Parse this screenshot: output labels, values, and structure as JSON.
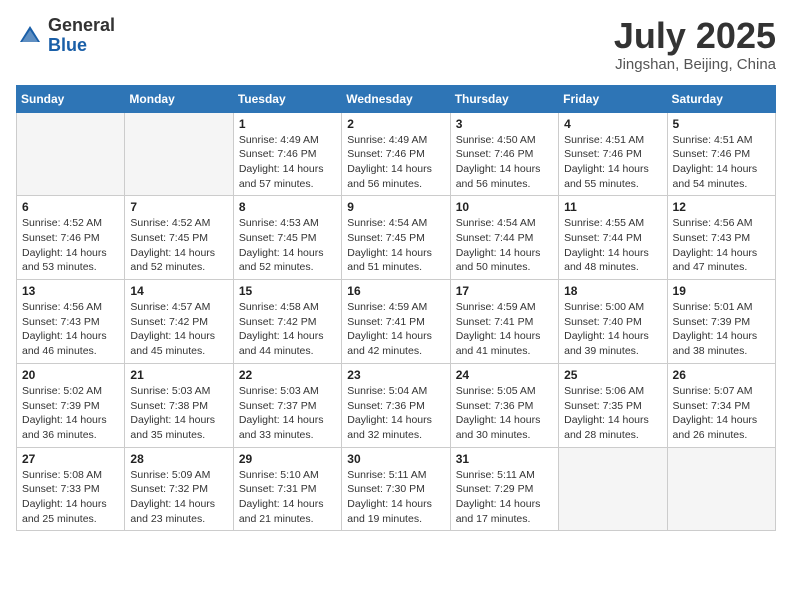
{
  "header": {
    "logo_general": "General",
    "logo_blue": "Blue",
    "month_title": "July 2025",
    "location": "Jingshan, Beijing, China"
  },
  "weekdays": [
    "Sunday",
    "Monday",
    "Tuesday",
    "Wednesday",
    "Thursday",
    "Friday",
    "Saturday"
  ],
  "weeks": [
    [
      {
        "day": "",
        "empty": true
      },
      {
        "day": "",
        "empty": true
      },
      {
        "day": "1",
        "sunrise": "Sunrise: 4:49 AM",
        "sunset": "Sunset: 7:46 PM",
        "daylight": "Daylight: 14 hours and 57 minutes."
      },
      {
        "day": "2",
        "sunrise": "Sunrise: 4:49 AM",
        "sunset": "Sunset: 7:46 PM",
        "daylight": "Daylight: 14 hours and 56 minutes."
      },
      {
        "day": "3",
        "sunrise": "Sunrise: 4:50 AM",
        "sunset": "Sunset: 7:46 PM",
        "daylight": "Daylight: 14 hours and 56 minutes."
      },
      {
        "day": "4",
        "sunrise": "Sunrise: 4:51 AM",
        "sunset": "Sunset: 7:46 PM",
        "daylight": "Daylight: 14 hours and 55 minutes."
      },
      {
        "day": "5",
        "sunrise": "Sunrise: 4:51 AM",
        "sunset": "Sunset: 7:46 PM",
        "daylight": "Daylight: 14 hours and 54 minutes."
      }
    ],
    [
      {
        "day": "6",
        "sunrise": "Sunrise: 4:52 AM",
        "sunset": "Sunset: 7:46 PM",
        "daylight": "Daylight: 14 hours and 53 minutes."
      },
      {
        "day": "7",
        "sunrise": "Sunrise: 4:52 AM",
        "sunset": "Sunset: 7:45 PM",
        "daylight": "Daylight: 14 hours and 52 minutes."
      },
      {
        "day": "8",
        "sunrise": "Sunrise: 4:53 AM",
        "sunset": "Sunset: 7:45 PM",
        "daylight": "Daylight: 14 hours and 52 minutes."
      },
      {
        "day": "9",
        "sunrise": "Sunrise: 4:54 AM",
        "sunset": "Sunset: 7:45 PM",
        "daylight": "Daylight: 14 hours and 51 minutes."
      },
      {
        "day": "10",
        "sunrise": "Sunrise: 4:54 AM",
        "sunset": "Sunset: 7:44 PM",
        "daylight": "Daylight: 14 hours and 50 minutes."
      },
      {
        "day": "11",
        "sunrise": "Sunrise: 4:55 AM",
        "sunset": "Sunset: 7:44 PM",
        "daylight": "Daylight: 14 hours and 48 minutes."
      },
      {
        "day": "12",
        "sunrise": "Sunrise: 4:56 AM",
        "sunset": "Sunset: 7:43 PM",
        "daylight": "Daylight: 14 hours and 47 minutes."
      }
    ],
    [
      {
        "day": "13",
        "sunrise": "Sunrise: 4:56 AM",
        "sunset": "Sunset: 7:43 PM",
        "daylight": "Daylight: 14 hours and 46 minutes."
      },
      {
        "day": "14",
        "sunrise": "Sunrise: 4:57 AM",
        "sunset": "Sunset: 7:42 PM",
        "daylight": "Daylight: 14 hours and 45 minutes."
      },
      {
        "day": "15",
        "sunrise": "Sunrise: 4:58 AM",
        "sunset": "Sunset: 7:42 PM",
        "daylight": "Daylight: 14 hours and 44 minutes."
      },
      {
        "day": "16",
        "sunrise": "Sunrise: 4:59 AM",
        "sunset": "Sunset: 7:41 PM",
        "daylight": "Daylight: 14 hours and 42 minutes."
      },
      {
        "day": "17",
        "sunrise": "Sunrise: 4:59 AM",
        "sunset": "Sunset: 7:41 PM",
        "daylight": "Daylight: 14 hours and 41 minutes."
      },
      {
        "day": "18",
        "sunrise": "Sunrise: 5:00 AM",
        "sunset": "Sunset: 7:40 PM",
        "daylight": "Daylight: 14 hours and 39 minutes."
      },
      {
        "day": "19",
        "sunrise": "Sunrise: 5:01 AM",
        "sunset": "Sunset: 7:39 PM",
        "daylight": "Daylight: 14 hours and 38 minutes."
      }
    ],
    [
      {
        "day": "20",
        "sunrise": "Sunrise: 5:02 AM",
        "sunset": "Sunset: 7:39 PM",
        "daylight": "Daylight: 14 hours and 36 minutes."
      },
      {
        "day": "21",
        "sunrise": "Sunrise: 5:03 AM",
        "sunset": "Sunset: 7:38 PM",
        "daylight": "Daylight: 14 hours and 35 minutes."
      },
      {
        "day": "22",
        "sunrise": "Sunrise: 5:03 AM",
        "sunset": "Sunset: 7:37 PM",
        "daylight": "Daylight: 14 hours and 33 minutes."
      },
      {
        "day": "23",
        "sunrise": "Sunrise: 5:04 AM",
        "sunset": "Sunset: 7:36 PM",
        "daylight": "Daylight: 14 hours and 32 minutes."
      },
      {
        "day": "24",
        "sunrise": "Sunrise: 5:05 AM",
        "sunset": "Sunset: 7:36 PM",
        "daylight": "Daylight: 14 hours and 30 minutes."
      },
      {
        "day": "25",
        "sunrise": "Sunrise: 5:06 AM",
        "sunset": "Sunset: 7:35 PM",
        "daylight": "Daylight: 14 hours and 28 minutes."
      },
      {
        "day": "26",
        "sunrise": "Sunrise: 5:07 AM",
        "sunset": "Sunset: 7:34 PM",
        "daylight": "Daylight: 14 hours and 26 minutes."
      }
    ],
    [
      {
        "day": "27",
        "sunrise": "Sunrise: 5:08 AM",
        "sunset": "Sunset: 7:33 PM",
        "daylight": "Daylight: 14 hours and 25 minutes."
      },
      {
        "day": "28",
        "sunrise": "Sunrise: 5:09 AM",
        "sunset": "Sunset: 7:32 PM",
        "daylight": "Daylight: 14 hours and 23 minutes."
      },
      {
        "day": "29",
        "sunrise": "Sunrise: 5:10 AM",
        "sunset": "Sunset: 7:31 PM",
        "daylight": "Daylight: 14 hours and 21 minutes."
      },
      {
        "day": "30",
        "sunrise": "Sunrise: 5:11 AM",
        "sunset": "Sunset: 7:30 PM",
        "daylight": "Daylight: 14 hours and 19 minutes."
      },
      {
        "day": "31",
        "sunrise": "Sunrise: 5:11 AM",
        "sunset": "Sunset: 7:29 PM",
        "daylight": "Daylight: 14 hours and 17 minutes."
      },
      {
        "day": "",
        "empty": true
      },
      {
        "day": "",
        "empty": true
      }
    ]
  ]
}
